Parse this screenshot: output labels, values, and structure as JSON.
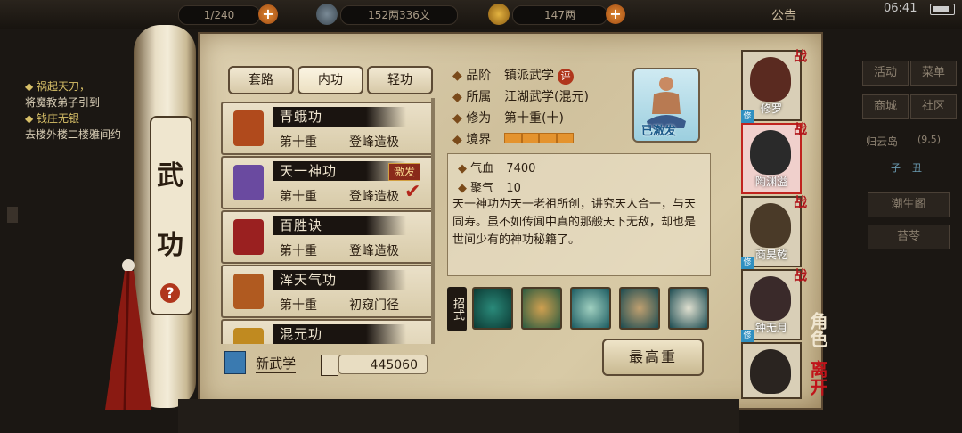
{
  "status_bar": {
    "stamina": "1/240",
    "copper": "152两336文",
    "silver": "147两",
    "notice": "公告",
    "clock": "06:41"
  },
  "quest_log": {
    "items": [
      {
        "title": "◆ 祸起天刀，",
        "text": "将魔教弟子引到"
      },
      {
        "title": "◆ 钱庄无银",
        "text": "去楼外楼二楼雅间约"
      }
    ]
  },
  "scroll": {
    "title_top": "武",
    "title_bottom": "功",
    "help": "?"
  },
  "tabs": [
    "套路",
    "内功",
    "轻功"
  ],
  "skills": [
    {
      "name": "青蛾功",
      "level": "第十重",
      "stage": "登峰造极",
      "color": "#b04a1c"
    },
    {
      "name": "天一神功",
      "level": "第十重",
      "stage": "登峰造极",
      "badge": "激发",
      "color": "#6a4aa0"
    },
    {
      "name": "百胜诀",
      "level": "第十重",
      "stage": "登峰造极",
      "color": "#9a2020"
    },
    {
      "name": "浑天气功",
      "level": "第十重",
      "stage": "初窥门径",
      "color": "#b05a20"
    },
    {
      "name": "混元功",
      "level": "",
      "stage": "",
      "color": "#c08a20"
    }
  ],
  "new_skill": {
    "label": "新武学",
    "count": "445060"
  },
  "detail": {
    "grade_label": "品阶",
    "grade": "镇派武学",
    "eval_badge": "评",
    "belong_label": "所属",
    "belong": "江湖武学(混元)",
    "cultivation_label": "修为",
    "cultivation": "第十重(十)",
    "realm_label": "境界",
    "realm_level": 1.0,
    "portrait_label": "已激发",
    "stats": [
      {
        "label": "气血",
        "value": "7400"
      },
      {
        "label": "聚气",
        "value": "10"
      }
    ],
    "description": "天一神功为天一老祖所创，讲究天人合一，与天同寿。虽不如传闻中真的那般天下无敌，却也是世间少有的神功秘籍了。",
    "moves_label": "招式",
    "max_button": "最高重"
  },
  "roster": [
    {
      "name": "修罗",
      "war": "战",
      "xiu": "修"
    },
    {
      "name": "陶渊溢",
      "war": "战",
      "xiu": "",
      "selected": true
    },
    {
      "name": "商昊乾",
      "war": "战",
      "xiu": "修"
    },
    {
      "name": "钟无月",
      "war": "战",
      "xiu": "修"
    },
    {
      "name": "",
      "war": "",
      "xiu": ""
    }
  ],
  "side_labels": {
    "role": "角色",
    "leave": "离开"
  },
  "right_menu": {
    "buttons": [
      "活动",
      "菜单",
      "商城",
      "社区"
    ],
    "location": "归云岛",
    "coords": "(9,5)",
    "time_a": "子",
    "time_b": "丑",
    "tide": "潮生阁",
    "herb": "苔苓"
  },
  "colors": {
    "accent_red": "#b0141a",
    "parchment": "#d3c5a2",
    "dark": "#1b1713"
  }
}
